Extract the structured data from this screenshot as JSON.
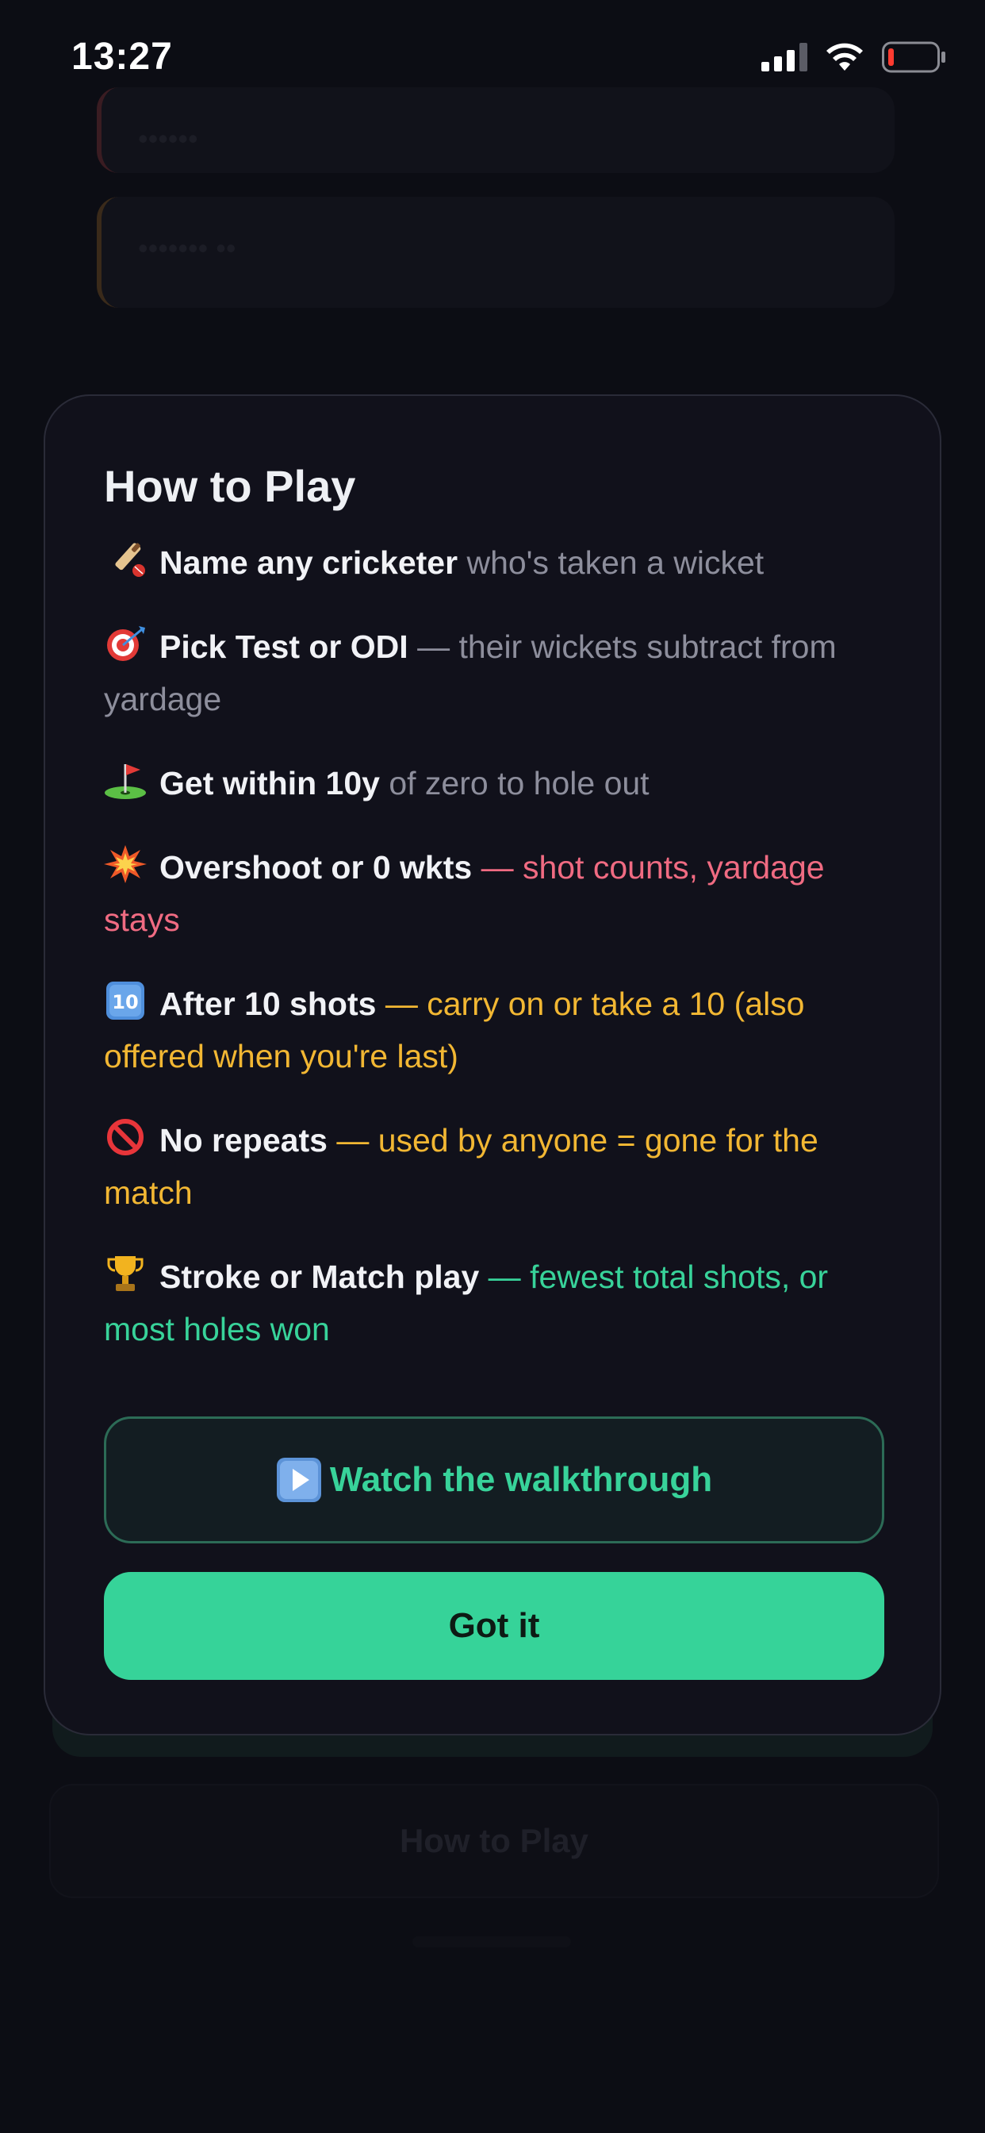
{
  "status_bar": {
    "time": "13:27",
    "icons": [
      "signal-icon",
      "wifi-icon",
      "battery-icon"
    ]
  },
  "background": {
    "card_1_text": "••••••",
    "card_2_text": "••••••• ••",
    "howto_button_label": "How to Play"
  },
  "modal": {
    "title": "How to Play",
    "rules": [
      {
        "icon": "cricket-bat-icon",
        "bold": "Name any cricketer",
        "rest": " who's taken a wicket",
        "tone": "muted"
      },
      {
        "icon": "dart-target-icon",
        "bold": "Pick Test or ODI",
        "rest": " — their wickets subtract from yardage",
        "tone": "muted"
      },
      {
        "icon": "golf-flag-icon",
        "bold": "Get within 10y",
        "rest": " of zero to hole out",
        "tone": "muted"
      },
      {
        "icon": "collision-icon",
        "bold": "Overshoot or 0 wkts",
        "rest": " — shot counts, yardage stays",
        "tone": "red"
      },
      {
        "icon": "keycap-ten-icon",
        "bold": "After 10 shots",
        "rest": " — carry on or take a 10 (also offered when you're last)",
        "tone": "amber"
      },
      {
        "icon": "prohibited-icon",
        "bold": "No repeats",
        "rest": " — used by anyone = gone for the match",
        "tone": "amber"
      },
      {
        "icon": "trophy-icon",
        "bold": "Stroke or Match play",
        "rest": " — fewest total shots, or most holes won",
        "tone": "green"
      }
    ],
    "walkthrough_label": "Watch the walkthrough",
    "got_it_label": "Got it"
  },
  "colors": {
    "background": "#0c0d14",
    "modal": "#11111b",
    "accent_green": "#36d399",
    "muted_text": "#8d8e9c",
    "red_text": "#f06b82",
    "amber_text": "#f2b733",
    "green_text": "#38d39a"
  }
}
